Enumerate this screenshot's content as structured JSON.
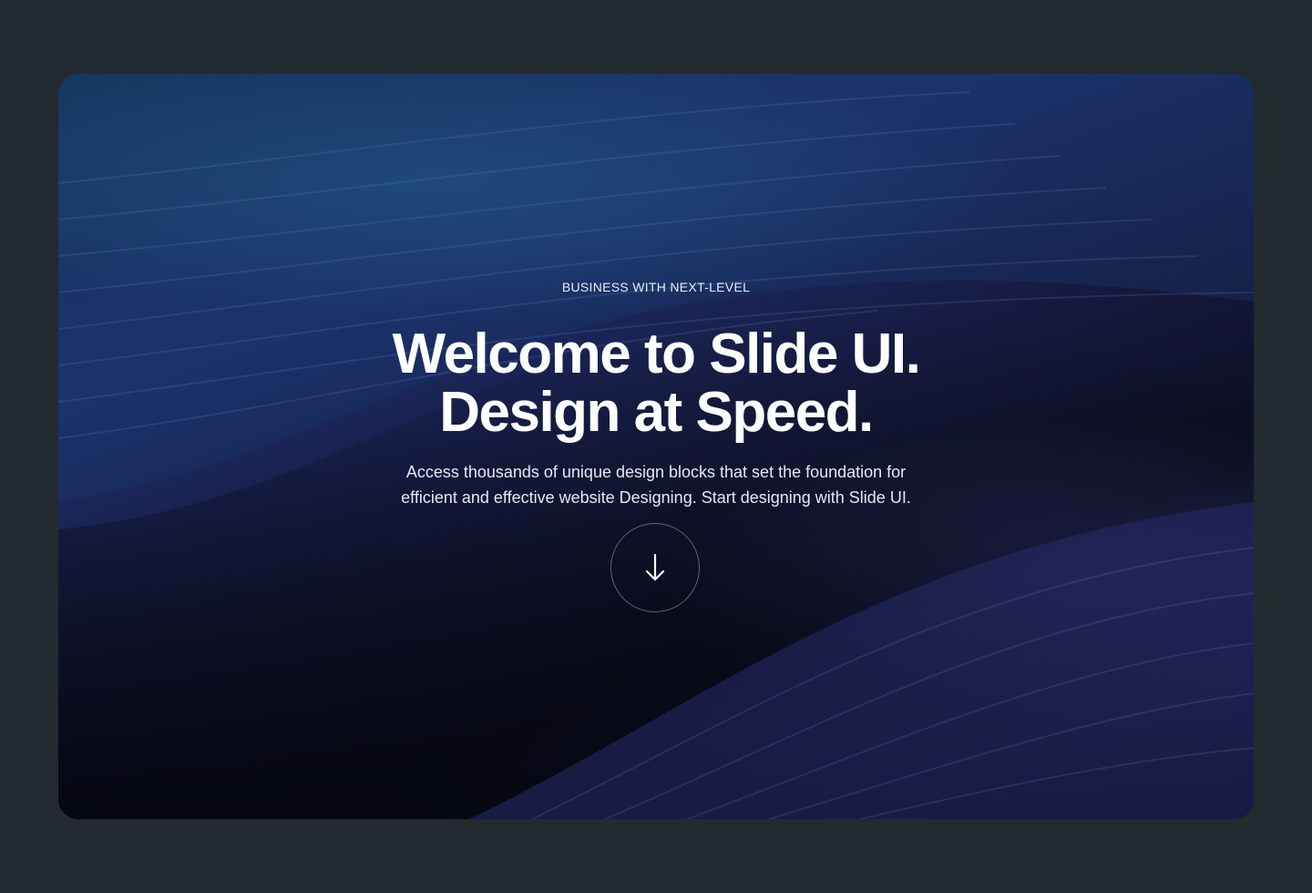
{
  "hero": {
    "eyebrow": "BUSINESS WITH NEXT-LEVEL",
    "headline_line1": "Welcome to Slide UI.",
    "headline_line2": "Design at Speed.",
    "subtitle_line1": "Access thousands of unique design blocks that set the foundation for",
    "subtitle_line2": "efficient and effective website Designing. Start designing with Slide UI.",
    "scroll_icon": "arrow-down-icon"
  },
  "colors": {
    "page_background": "#232a30",
    "text": "#ffffff",
    "hero_deep_navy": "#0a0c1c",
    "hero_blue": "#1d2f6b",
    "hero_teal": "#14365a"
  }
}
